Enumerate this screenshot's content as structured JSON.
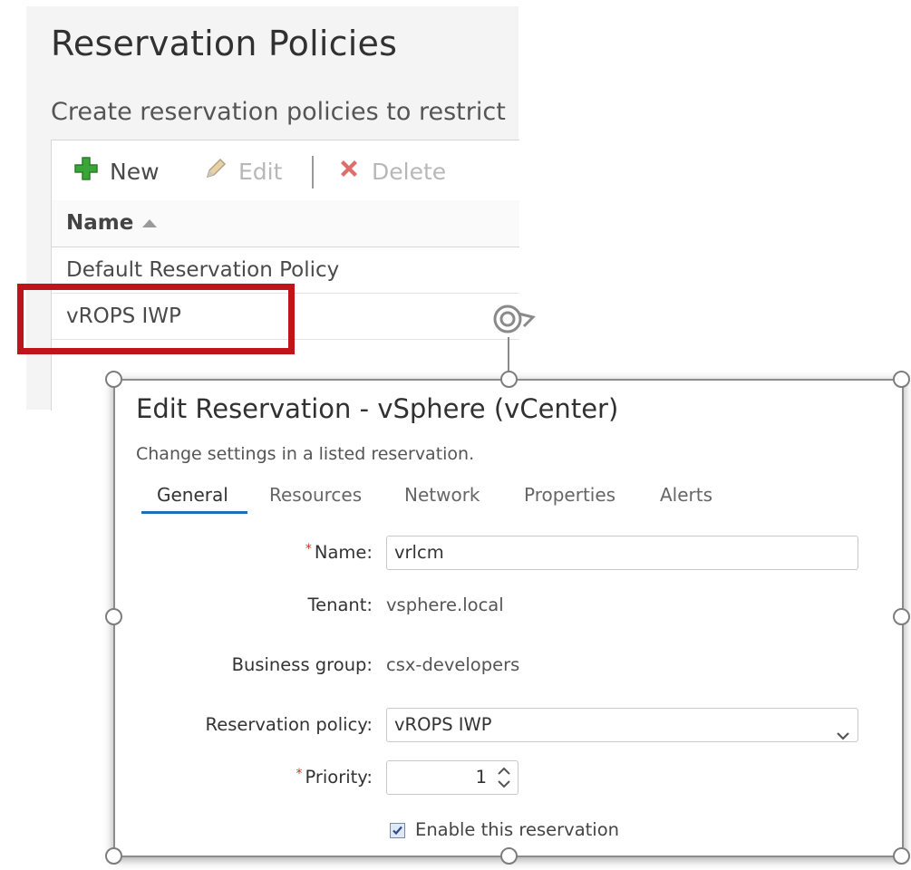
{
  "policies_panel": {
    "title": "Reservation Policies",
    "description": "Create reservation policies to restrict",
    "toolbar": {
      "new_label": "New",
      "edit_label": "Edit",
      "delete_label": "Delete"
    },
    "column_header": "Name",
    "rows": [
      "Default Reservation Policy",
      "vROPS IWP"
    ]
  },
  "dialog": {
    "title": "Edit Reservation - vSphere (vCenter)",
    "subtitle": "Change settings in a listed reservation.",
    "tabs": [
      "General",
      "Resources",
      "Network",
      "Properties",
      "Alerts"
    ],
    "active_tab": "General",
    "fields": {
      "name_label": "Name:",
      "name_value": "vrlcm",
      "tenant_label": "Tenant:",
      "tenant_value": "vsphere.local",
      "business_group_label": "Business group:",
      "business_group_value": "csx-developers",
      "reservation_policy_label": "Reservation policy:",
      "reservation_policy_value": "vROPS IWP",
      "priority_label": "Priority:",
      "priority_value": "1",
      "enable_label": "Enable this reservation",
      "enable_checked": true
    }
  },
  "colors": {
    "highlight": "#c0141b",
    "tab_underline": "#1e6fb5",
    "new_icon": "#3aa637",
    "delete_icon": "#d9534f"
  }
}
